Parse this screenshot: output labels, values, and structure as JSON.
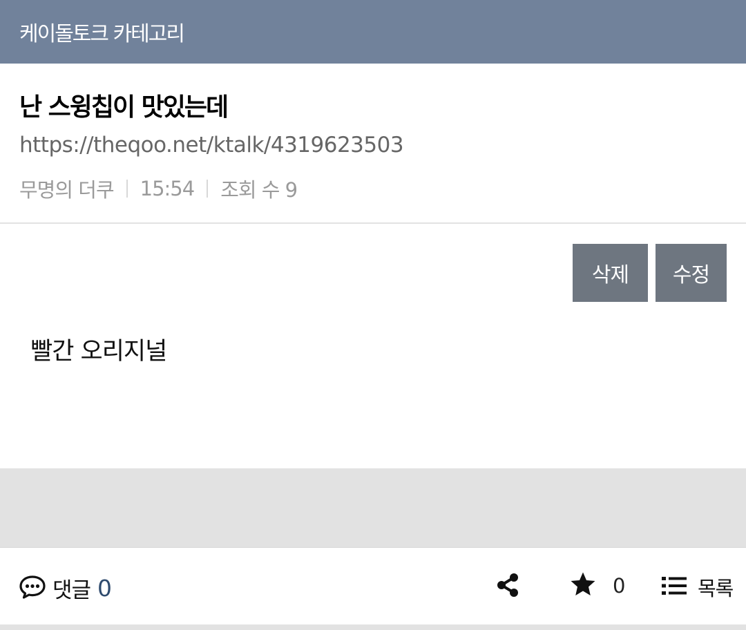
{
  "topbar": {
    "category": "케이돌토크 카테고리"
  },
  "post": {
    "title": "난 스윙칩이 맛있는데",
    "url": "https://theqoo.net/ktalk/4319623503",
    "author": "무명의 더쿠",
    "time": "15:54",
    "views_label": "조회 수 9"
  },
  "actions": {
    "delete_label": "삭제",
    "edit_label": "수정"
  },
  "content": {
    "body": "빨간 오리지널"
  },
  "footer": {
    "comments_label": "댓글",
    "comments_count": "0",
    "star_count": "0",
    "list_label": "목록"
  },
  "icons": {
    "comment": "speech-bubble-icon",
    "share": "share-icon",
    "star": "star-icon",
    "list": "list-icon"
  },
  "colors": {
    "topbar": "#71829b",
    "button": "#6e7680",
    "comment_count": "#2f4b6e"
  }
}
